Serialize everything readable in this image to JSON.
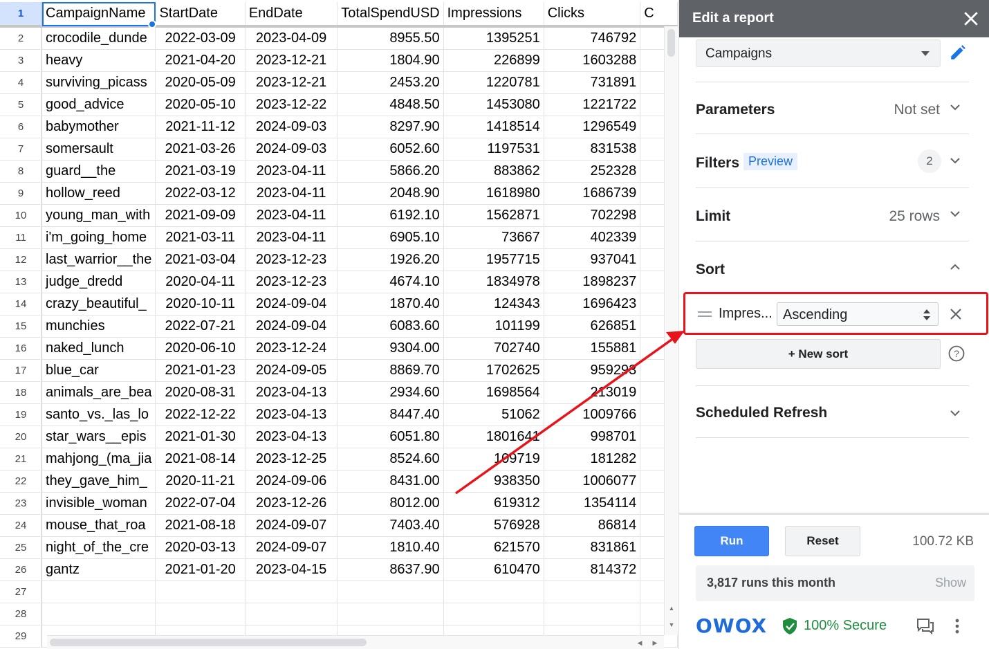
{
  "sheet": {
    "header_row_number": "1",
    "columns": [
      "CampaignName",
      "StartDate",
      "EndDate",
      "TotalSpendUSD",
      "Impressions",
      "Clicks",
      "C"
    ],
    "rows": [
      {
        "n": "2",
        "c": [
          "crocodile_dunde",
          "2022-03-09",
          "2023-04-09",
          "8955.50",
          "1395251",
          "746792"
        ]
      },
      {
        "n": "3",
        "c": [
          "heavy",
          "2021-04-20",
          "2023-12-21",
          "1804.90",
          "226899",
          "1603288"
        ]
      },
      {
        "n": "4",
        "c": [
          "surviving_picass",
          "2020-05-09",
          "2023-12-21",
          "2453.20",
          "1220781",
          "731891"
        ]
      },
      {
        "n": "5",
        "c": [
          "good_advice",
          "2020-05-10",
          "2023-12-22",
          "4848.50",
          "1453080",
          "1221722"
        ]
      },
      {
        "n": "6",
        "c": [
          "babymother",
          "2021-11-12",
          "2024-09-03",
          "8297.90",
          "1418514",
          "1296549"
        ]
      },
      {
        "n": "7",
        "c": [
          "somersault",
          "2021-03-26",
          "2024-09-03",
          "6052.60",
          "1197531",
          "831538"
        ]
      },
      {
        "n": "8",
        "c": [
          "guard__the",
          "2021-03-19",
          "2023-04-11",
          "5866.20",
          "883862",
          "252328"
        ]
      },
      {
        "n": "9",
        "c": [
          "hollow_reed",
          "2022-03-12",
          "2023-04-11",
          "2048.90",
          "1618980",
          "1686739"
        ]
      },
      {
        "n": "10",
        "c": [
          "young_man_with",
          "2021-09-09",
          "2023-04-11",
          "6192.10",
          "1562871",
          "702298"
        ]
      },
      {
        "n": "11",
        "c": [
          "i'm_going_home",
          "2021-03-11",
          "2023-04-11",
          "6905.10",
          "73667",
          "402339"
        ]
      },
      {
        "n": "12",
        "c": [
          "last_warrior__the",
          "2021-03-04",
          "2023-12-23",
          "1926.20",
          "1957715",
          "937041"
        ]
      },
      {
        "n": "13",
        "c": [
          "judge_dredd",
          "2020-04-11",
          "2023-12-23",
          "4674.10",
          "1834978",
          "1898237"
        ]
      },
      {
        "n": "14",
        "c": [
          "crazy_beautiful_",
          "2020-10-11",
          "2024-09-04",
          "1870.40",
          "124343",
          "1696423"
        ]
      },
      {
        "n": "15",
        "c": [
          "munchies",
          "2022-07-21",
          "2024-09-04",
          "6083.60",
          "101199",
          "626851"
        ]
      },
      {
        "n": "16",
        "c": [
          "naked_lunch",
          "2020-06-10",
          "2023-12-24",
          "9304.00",
          "702740",
          "155881"
        ]
      },
      {
        "n": "17",
        "c": [
          "blue_car",
          "2021-01-23",
          "2024-09-05",
          "8869.70",
          "1702625",
          "959293"
        ]
      },
      {
        "n": "18",
        "c": [
          "animals_are_bea",
          "2020-08-31",
          "2023-04-13",
          "2934.60",
          "1698564",
          "213019"
        ]
      },
      {
        "n": "19",
        "c": [
          "santo_vs._las_lo",
          "2022-12-22",
          "2023-04-13",
          "8447.40",
          "51062",
          "1009766"
        ]
      },
      {
        "n": "20",
        "c": [
          "star_wars__epis",
          "2021-01-30",
          "2023-04-13",
          "6051.80",
          "1801641",
          "998701"
        ]
      },
      {
        "n": "21",
        "c": [
          "mahjong_(ma_jia",
          "2021-08-14",
          "2023-12-25",
          "8524.60",
          "109719",
          "181282"
        ]
      },
      {
        "n": "22",
        "c": [
          "they_gave_him_",
          "2020-11-21",
          "2024-09-06",
          "8431.00",
          "938350",
          "1006077"
        ]
      },
      {
        "n": "23",
        "c": [
          "invisible_woman",
          "2022-07-04",
          "2023-12-26",
          "8012.00",
          "619312",
          "1354114"
        ]
      },
      {
        "n": "24",
        "c": [
          "mouse_that_roa",
          "2021-08-18",
          "2024-09-07",
          "7403.40",
          "576928",
          "86814"
        ]
      },
      {
        "n": "25",
        "c": [
          "night_of_the_cre",
          "2020-03-13",
          "2024-09-07",
          "1810.40",
          "621570",
          "831861"
        ]
      },
      {
        "n": "26",
        "c": [
          "gantz",
          "2021-01-20",
          "2023-04-15",
          "8637.90",
          "610470",
          "814372"
        ]
      },
      {
        "n": "27",
        "c": [
          "",
          "",
          "",
          "",
          "",
          ""
        ]
      },
      {
        "n": "28",
        "c": [
          "",
          "",
          "",
          "",
          "",
          ""
        ]
      },
      {
        "n": "29",
        "c": [
          "",
          "",
          "",
          "",
          "",
          ""
        ]
      }
    ]
  },
  "panel": {
    "title": "Edit a report",
    "data_source": "Campaigns",
    "parameters": {
      "label": "Parameters",
      "value": "Not set"
    },
    "filters": {
      "label": "Filters",
      "badge": "Preview",
      "count": "2"
    },
    "limit": {
      "label": "Limit",
      "value": "25 rows"
    },
    "sort": {
      "label": "Sort",
      "field": "Impres...",
      "order": "Ascending",
      "new_sort": "+ New sort"
    },
    "scheduled_refresh": {
      "label": "Scheduled Refresh"
    },
    "run_label": "Run",
    "reset_label": "Reset",
    "size": "100.72 KB",
    "runs_text": "3,817 runs this month",
    "show_label": "Show",
    "brand": "OWOX",
    "secure_text": "100% Secure"
  },
  "colors": {
    "accent": "#1a73e8",
    "header_bar": "#5f6368",
    "run_button": "#4285f4",
    "secure_green": "#1e8e3e",
    "annotation_red": "#e8131b",
    "brand_blue": "#1f6cd8"
  },
  "icons": [
    "close-icon",
    "pencil-icon",
    "chevron-down-icon",
    "chevron-up-icon",
    "drag-handle-icon",
    "help-icon",
    "shield-check-icon",
    "chat-icon",
    "more-vert-icon"
  ]
}
